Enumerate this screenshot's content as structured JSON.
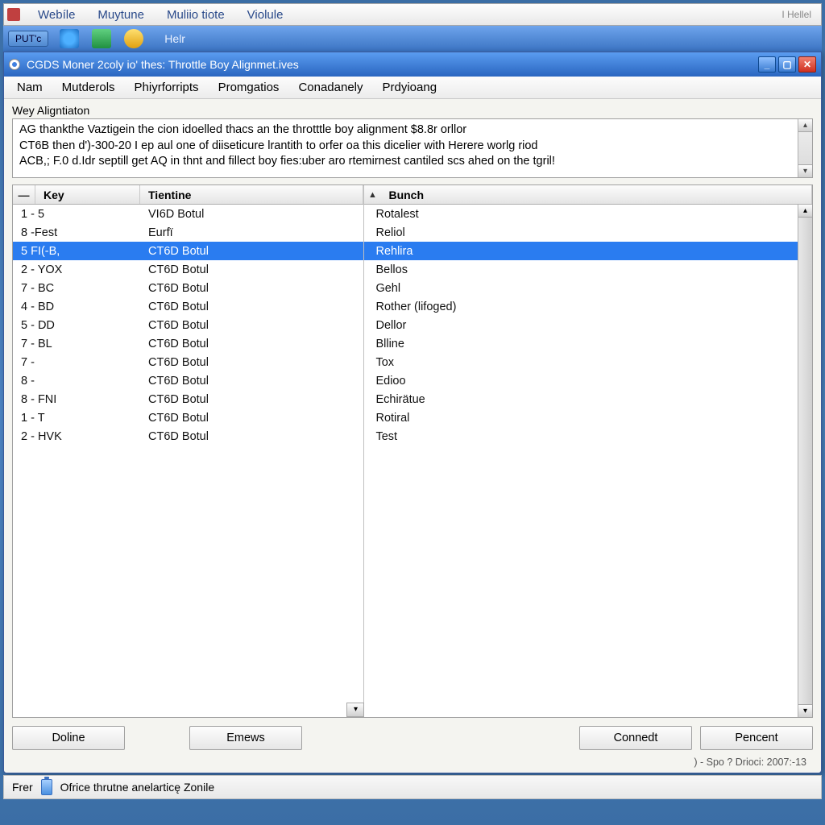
{
  "top_menu": {
    "items": [
      "Webíle",
      "Muytune",
      "Muliio tiote",
      "Violule"
    ],
    "right_label": "I Hellel"
  },
  "toolbar": {
    "left_btn": "PUT'c",
    "help": "Helr"
  },
  "window": {
    "title": "CGDS Moner 2coly io' thes: Throttle Boy Alignmet.ives",
    "menu": [
      "Nam",
      "Mutderols",
      "Phiyrforripts",
      "Promgatios",
      "Conadanely",
      "Prdyioang"
    ],
    "controls": {
      "min": "_",
      "max": "▢",
      "close": "✕"
    }
  },
  "desc": {
    "label": "Wey Aligntiaton",
    "line1": "AG thankthe Vaztigein the cion idoelled thacs an the throtttle boy alignment $8.8r orllor",
    "line2": "CT6B then d')-300-20 I ep aul one of diiseticure lrantith to orfer oa this dicelier with Herere worlg riod",
    "line3": "ACB,; F.0 d.Idr septill get AQ in thnt and fillect boy fies:uber aro rtemirnest cantiled scs ahed on the tgril!"
  },
  "columns": {
    "key": "Key",
    "tientine": "Tientine",
    "bunch": "Bunch",
    "sort_glyph": "▲",
    "expand_glyph": "—"
  },
  "left_rows": [
    {
      "key": "1 - 5",
      "t": "VI6D Botul"
    },
    {
      "key": "8 -Fest",
      "t": "Eurfï"
    },
    {
      "key": "5 FI(-B,",
      "t": "CT6D Botul",
      "selected": true
    },
    {
      "key": "2 - YOX",
      "t": "CT6D Botul"
    },
    {
      "key": "7 - BC",
      "t": "CT6D Botul"
    },
    {
      "key": "4 - BD",
      "t": "CT6D Botul"
    },
    {
      "key": "5 - DD",
      "t": "CT6D Botul"
    },
    {
      "key": "7 - BL",
      "t": "CT6D Botul"
    },
    {
      "key": "7 -",
      "t": "CT6D Botul"
    },
    {
      "key": "8 -",
      "t": "CT6D Botul"
    },
    {
      "key": "8 - FNI",
      "t": "CT6D Botul"
    },
    {
      "key": "1 - T",
      "t": "CT6D Botul"
    },
    {
      "key": "2 - HVK",
      "t": "CT6D Botul"
    }
  ],
  "right_rows": [
    {
      "b": "Rotalest"
    },
    {
      "b": "Reliol"
    },
    {
      "b": "Rehlira",
      "selected": true
    },
    {
      "b": "Bellos"
    },
    {
      "b": "Gehl"
    },
    {
      "b": "Rother (lifoged)"
    },
    {
      "b": "Dellor"
    },
    {
      "b": "Blline"
    },
    {
      "b": "Tox"
    },
    {
      "b": "Edioo"
    },
    {
      "b": "Echirätue"
    },
    {
      "b": "Rotiral"
    },
    {
      "b": "Test"
    }
  ],
  "buttons": {
    "doline": "Doline",
    "emews": "Emews",
    "connedt": "Connedt",
    "pencent": "Pencent"
  },
  "status_right": ") - Spo ? Drioci: 2007:-13",
  "bottom": {
    "left": "Frer",
    "text": "Ofrice thrutne anelarticę Zonile"
  }
}
